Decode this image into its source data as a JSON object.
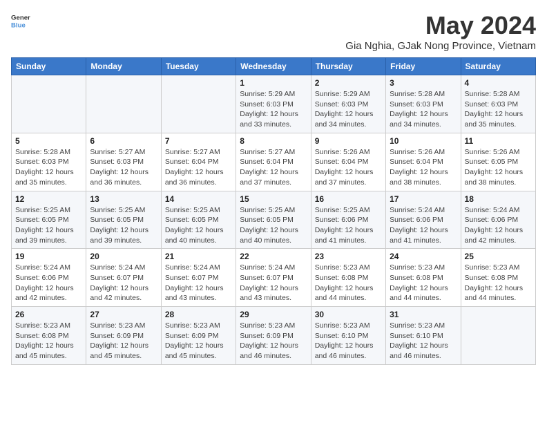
{
  "header": {
    "logo_line1": "General",
    "logo_line2": "Blue",
    "title": "May 2024",
    "subtitle": "Gia Nghia, GJak Nong Province, Vietnam"
  },
  "days_of_week": [
    "Sunday",
    "Monday",
    "Tuesday",
    "Wednesday",
    "Thursday",
    "Friday",
    "Saturday"
  ],
  "weeks": [
    [
      {
        "day": "",
        "sunrise": "",
        "sunset": "",
        "daylight": ""
      },
      {
        "day": "",
        "sunrise": "",
        "sunset": "",
        "daylight": ""
      },
      {
        "day": "",
        "sunrise": "",
        "sunset": "",
        "daylight": ""
      },
      {
        "day": "1",
        "sunrise": "Sunrise: 5:29 AM",
        "sunset": "Sunset: 6:03 PM",
        "daylight": "Daylight: 12 hours and 33 minutes."
      },
      {
        "day": "2",
        "sunrise": "Sunrise: 5:29 AM",
        "sunset": "Sunset: 6:03 PM",
        "daylight": "Daylight: 12 hours and 34 minutes."
      },
      {
        "day": "3",
        "sunrise": "Sunrise: 5:28 AM",
        "sunset": "Sunset: 6:03 PM",
        "daylight": "Daylight: 12 hours and 34 minutes."
      },
      {
        "day": "4",
        "sunrise": "Sunrise: 5:28 AM",
        "sunset": "Sunset: 6:03 PM",
        "daylight": "Daylight: 12 hours and 35 minutes."
      }
    ],
    [
      {
        "day": "5",
        "sunrise": "Sunrise: 5:28 AM",
        "sunset": "Sunset: 6:03 PM",
        "daylight": "Daylight: 12 hours and 35 minutes."
      },
      {
        "day": "6",
        "sunrise": "Sunrise: 5:27 AM",
        "sunset": "Sunset: 6:03 PM",
        "daylight": "Daylight: 12 hours and 36 minutes."
      },
      {
        "day": "7",
        "sunrise": "Sunrise: 5:27 AM",
        "sunset": "Sunset: 6:04 PM",
        "daylight": "Daylight: 12 hours and 36 minutes."
      },
      {
        "day": "8",
        "sunrise": "Sunrise: 5:27 AM",
        "sunset": "Sunset: 6:04 PM",
        "daylight": "Daylight: 12 hours and 37 minutes."
      },
      {
        "day": "9",
        "sunrise": "Sunrise: 5:26 AM",
        "sunset": "Sunset: 6:04 PM",
        "daylight": "Daylight: 12 hours and 37 minutes."
      },
      {
        "day": "10",
        "sunrise": "Sunrise: 5:26 AM",
        "sunset": "Sunset: 6:04 PM",
        "daylight": "Daylight: 12 hours and 38 minutes."
      },
      {
        "day": "11",
        "sunrise": "Sunrise: 5:26 AM",
        "sunset": "Sunset: 6:05 PM",
        "daylight": "Daylight: 12 hours and 38 minutes."
      }
    ],
    [
      {
        "day": "12",
        "sunrise": "Sunrise: 5:25 AM",
        "sunset": "Sunset: 6:05 PM",
        "daylight": "Daylight: 12 hours and 39 minutes."
      },
      {
        "day": "13",
        "sunrise": "Sunrise: 5:25 AM",
        "sunset": "Sunset: 6:05 PM",
        "daylight": "Daylight: 12 hours and 39 minutes."
      },
      {
        "day": "14",
        "sunrise": "Sunrise: 5:25 AM",
        "sunset": "Sunset: 6:05 PM",
        "daylight": "Daylight: 12 hours and 40 minutes."
      },
      {
        "day": "15",
        "sunrise": "Sunrise: 5:25 AM",
        "sunset": "Sunset: 6:05 PM",
        "daylight": "Daylight: 12 hours and 40 minutes."
      },
      {
        "day": "16",
        "sunrise": "Sunrise: 5:25 AM",
        "sunset": "Sunset: 6:06 PM",
        "daylight": "Daylight: 12 hours and 41 minutes."
      },
      {
        "day": "17",
        "sunrise": "Sunrise: 5:24 AM",
        "sunset": "Sunset: 6:06 PM",
        "daylight": "Daylight: 12 hours and 41 minutes."
      },
      {
        "day": "18",
        "sunrise": "Sunrise: 5:24 AM",
        "sunset": "Sunset: 6:06 PM",
        "daylight": "Daylight: 12 hours and 42 minutes."
      }
    ],
    [
      {
        "day": "19",
        "sunrise": "Sunrise: 5:24 AM",
        "sunset": "Sunset: 6:06 PM",
        "daylight": "Daylight: 12 hours and 42 minutes."
      },
      {
        "day": "20",
        "sunrise": "Sunrise: 5:24 AM",
        "sunset": "Sunset: 6:07 PM",
        "daylight": "Daylight: 12 hours and 42 minutes."
      },
      {
        "day": "21",
        "sunrise": "Sunrise: 5:24 AM",
        "sunset": "Sunset: 6:07 PM",
        "daylight": "Daylight: 12 hours and 43 minutes."
      },
      {
        "day": "22",
        "sunrise": "Sunrise: 5:24 AM",
        "sunset": "Sunset: 6:07 PM",
        "daylight": "Daylight: 12 hours and 43 minutes."
      },
      {
        "day": "23",
        "sunrise": "Sunrise: 5:23 AM",
        "sunset": "Sunset: 6:08 PM",
        "daylight": "Daylight: 12 hours and 44 minutes."
      },
      {
        "day": "24",
        "sunrise": "Sunrise: 5:23 AM",
        "sunset": "Sunset: 6:08 PM",
        "daylight": "Daylight: 12 hours and 44 minutes."
      },
      {
        "day": "25",
        "sunrise": "Sunrise: 5:23 AM",
        "sunset": "Sunset: 6:08 PM",
        "daylight": "Daylight: 12 hours and 44 minutes."
      }
    ],
    [
      {
        "day": "26",
        "sunrise": "Sunrise: 5:23 AM",
        "sunset": "Sunset: 6:08 PM",
        "daylight": "Daylight: 12 hours and 45 minutes."
      },
      {
        "day": "27",
        "sunrise": "Sunrise: 5:23 AM",
        "sunset": "Sunset: 6:09 PM",
        "daylight": "Daylight: 12 hours and 45 minutes."
      },
      {
        "day": "28",
        "sunrise": "Sunrise: 5:23 AM",
        "sunset": "Sunset: 6:09 PM",
        "daylight": "Daylight: 12 hours and 45 minutes."
      },
      {
        "day": "29",
        "sunrise": "Sunrise: 5:23 AM",
        "sunset": "Sunset: 6:09 PM",
        "daylight": "Daylight: 12 hours and 46 minutes."
      },
      {
        "day": "30",
        "sunrise": "Sunrise: 5:23 AM",
        "sunset": "Sunset: 6:10 PM",
        "daylight": "Daylight: 12 hours and 46 minutes."
      },
      {
        "day": "31",
        "sunrise": "Sunrise: 5:23 AM",
        "sunset": "Sunset: 6:10 PM",
        "daylight": "Daylight: 12 hours and 46 minutes."
      },
      {
        "day": "",
        "sunrise": "",
        "sunset": "",
        "daylight": ""
      }
    ]
  ]
}
